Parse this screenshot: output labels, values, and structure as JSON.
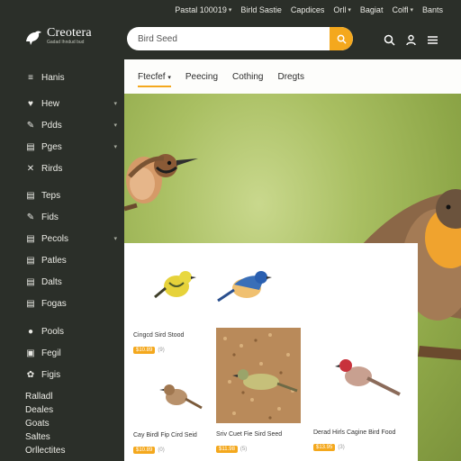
{
  "topbar": {
    "links": [
      {
        "label": "Pastal 100019",
        "chevron": true
      },
      {
        "label": "Birld Sastie",
        "chevron": false
      },
      {
        "label": "Capdices",
        "chevron": false
      },
      {
        "label": "Orll",
        "chevron": true
      },
      {
        "label": "Bagiat",
        "chevron": false
      },
      {
        "label": "Colfl",
        "chevron": true
      },
      {
        "label": "Bants",
        "chevron": false
      }
    ]
  },
  "header": {
    "logo_name": "Creotera",
    "logo_tagline": "Gadad Ihndud bud",
    "search_placeholder": "Bird Seed",
    "icons": [
      "search-icon",
      "user-icon",
      "menu-icon"
    ]
  },
  "sidebar": {
    "items": [
      {
        "label": "Hanis",
        "icon": "≡",
        "chevron": false
      },
      {
        "label": "Hew",
        "icon": "♥",
        "chevron": true
      },
      {
        "label": "Pdds",
        "icon": "✎",
        "chevron": true
      },
      {
        "label": "Pges",
        "icon": "▤",
        "chevron": true
      },
      {
        "label": "Rirds",
        "icon": "✕",
        "chevron": false
      },
      {
        "label": "Teps",
        "icon": "▤",
        "chevron": false
      },
      {
        "label": "Fids",
        "icon": "✎",
        "chevron": false
      },
      {
        "label": "Pecols",
        "icon": "▤",
        "chevron": true
      },
      {
        "label": "Patles",
        "icon": "▤",
        "chevron": false
      },
      {
        "label": "Dalts",
        "icon": "▤",
        "chevron": false
      },
      {
        "label": "Fogas",
        "icon": "▤",
        "chevron": false
      },
      {
        "label": "Pools",
        "icon": "●",
        "chevron": false
      },
      {
        "label": "Fegil",
        "icon": "▣",
        "chevron": false
      },
      {
        "label": "Figis",
        "icon": "✿",
        "chevron": false
      }
    ],
    "footer_links": [
      "Ralladl",
      "Deales",
      "Goats",
      "Saltes",
      "Orllectites"
    ]
  },
  "tabs": [
    {
      "label": "Ftecfef",
      "chevron": true,
      "active": true
    },
    {
      "label": "Peecing",
      "chevron": false,
      "active": false
    },
    {
      "label": "Cothing",
      "chevron": false,
      "active": false
    },
    {
      "label": "Dregts",
      "chevron": false,
      "active": false
    }
  ],
  "products": [
    {
      "title": "Cingcd Sird Stood",
      "price": "$10.89",
      "rating": "(9)"
    },
    {
      "title": "",
      "price": "",
      "rating": ""
    },
    {
      "title": "Cay Birdl Fip Cird Seid",
      "price": "$10.89",
      "rating": "(0)"
    },
    {
      "title": "Sriv Cuet Fie Sird Seed",
      "price": "$11.98",
      "rating": "(5)"
    },
    {
      "title": "Derad Hirls Cagine Bird Food",
      "price": "$13.95",
      "rating": "(3)"
    }
  ],
  "colors": {
    "accent": "#f4a81d",
    "sidebar_bg": "#2b2f29",
    "content_bg": "#f7f6f1"
  }
}
